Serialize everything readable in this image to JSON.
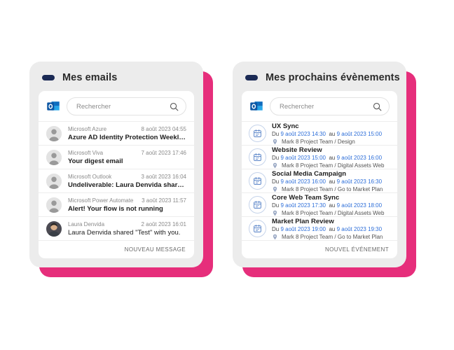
{
  "theme": {
    "shadow_pink": "#e62e7b",
    "card_bg": "#ececec",
    "panel_bg": "#ffffff",
    "title_color": "#2a2a2a",
    "accent_blue": "#2e6fd9",
    "pill_navy": "#1b2a55"
  },
  "emails_widget": {
    "title": "Mes emails",
    "title_icon": "pill-icon",
    "search": {
      "app_icon": "outlook-icon",
      "placeholder": "Rechercher",
      "value": "",
      "search_icon": "search-icon"
    },
    "items": [
      {
        "sender": "Microsoft Azure",
        "date": "8 août 2023 04:55",
        "subject": "Azure AD Identity Protection Weekly Digest",
        "bold": true,
        "avatar": "person-placeholder"
      },
      {
        "sender": "Microsoft Viva",
        "date": "7 août 2023 17:46",
        "subject": "Your digest email",
        "bold": true,
        "avatar": "person-placeholder"
      },
      {
        "sender": "Microsoft Outlook",
        "date": "3 août 2023 16:04",
        "subject": "Undeliverable: Laura Denvida shared \"Test\" w...",
        "bold": true,
        "avatar": "person-placeholder"
      },
      {
        "sender": "Microsoft Power Automate",
        "date": "3 août 2023 11:57",
        "subject": "Alert! Your flow is not running",
        "bold": true,
        "avatar": "person-placeholder"
      },
      {
        "sender": "Laura Denvida",
        "date": "2 août 2023 16:01",
        "subject": "Laura Denvida shared \"Test\" with you.",
        "bold": false,
        "avatar": "person-photo"
      }
    ],
    "footer_action": "NOUVEAU MESSAGE"
  },
  "events_widget": {
    "title": "Mes prochains évènements",
    "title_icon": "pill-icon",
    "search": {
      "app_icon": "outlook-icon",
      "placeholder": "Rechercher",
      "value": "",
      "search_icon": "search-icon"
    },
    "items": [
      {
        "title": "UX Sync",
        "prefix_from": "Du",
        "start": "9 août 2023 14:30",
        "prefix_to": "au",
        "end": "9 août 2023 15:00",
        "location": "Mark 8 Project Team / Design",
        "icon": "calendar-icon",
        "location_icon": "location-pin-icon"
      },
      {
        "title": "Website Review",
        "prefix_from": "Du",
        "start": "9 août 2023 15:00",
        "prefix_to": "au",
        "end": "9 août 2023 16:00",
        "location": "Mark 8 Project Team / Digital Assets Web",
        "icon": "calendar-icon",
        "location_icon": "location-pin-icon"
      },
      {
        "title": "Social Media Campaign",
        "prefix_from": "Du",
        "start": "9 août 2023 16:00",
        "prefix_to": "au",
        "end": "9 août 2023 16:30",
        "location": "Mark 8 Project Team / Go to Market Plan",
        "icon": "calendar-icon",
        "location_icon": "location-pin-icon"
      },
      {
        "title": "Core Web Team Sync",
        "prefix_from": "Du",
        "start": "9 août 2023 17:30",
        "prefix_to": "au",
        "end": "9 août 2023 18:00",
        "location": "Mark 8 Project Team / Digital Assets Web",
        "icon": "calendar-icon",
        "location_icon": "location-pin-icon"
      },
      {
        "title": "Market Plan Review",
        "prefix_from": "Du",
        "start": "9 août 2023 19:00",
        "prefix_to": "au",
        "end": "9 août 2023 19:30",
        "location": "Mark 8 Project Team / Go to Market Plan",
        "icon": "calendar-icon",
        "location_icon": "location-pin-icon"
      }
    ],
    "footer_action": "NOUVEL ÉVÉNEMENT"
  }
}
